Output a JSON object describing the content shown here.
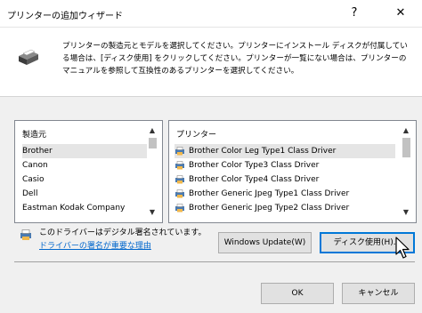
{
  "window": {
    "title": "プリンターの追加ウィザード",
    "help_glyph": "?",
    "close_glyph": "✕"
  },
  "header": {
    "description": "プリンターの製造元とモデルを選択してください。プリンターにインストール ディスクが付属している場合は、[ディスク使用] をクリックしてください。プリンターが一覧にない場合は、プリンターのマニュアルを参照して互換性のあるプリンターを選択してください。"
  },
  "manufacturer_list": {
    "header": "製造元",
    "items": [
      {
        "label": "Brother",
        "selected": true
      },
      {
        "label": "Canon",
        "selected": false
      },
      {
        "label": "Casio",
        "selected": false
      },
      {
        "label": "Dell",
        "selected": false
      },
      {
        "label": "Eastman Kodak Company",
        "selected": false
      }
    ]
  },
  "printer_list": {
    "header": "プリンター",
    "items": [
      {
        "label": "Brother Color Leg Type1 Class Driver",
        "selected": true
      },
      {
        "label": "Brother Color Type3 Class Driver",
        "selected": false
      },
      {
        "label": "Brother Color Type4 Class Driver",
        "selected": false
      },
      {
        "label": "Brother Generic Jpeg Type1 Class Driver",
        "selected": false
      },
      {
        "label": "Brother Generic Jpeg Type2 Class Driver",
        "selected": false
      }
    ]
  },
  "signature": {
    "text": "このドライバーはデジタル署名されています。",
    "link": "ドライバーの署名が重要な理由"
  },
  "buttons": {
    "windows_update": "Windows Update(W)",
    "have_disk": "ディスク使用(H)...",
    "ok": "OK",
    "cancel": "キャンセル"
  },
  "colors": {
    "accent": "#0078d7",
    "link": "#0066cc"
  }
}
